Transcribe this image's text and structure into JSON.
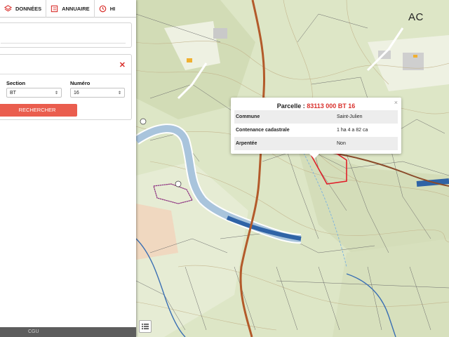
{
  "nav": {
    "tabs": [
      {
        "label": "DONNÉES",
        "icon": "layers-icon"
      },
      {
        "label": "ANNUAIRE",
        "icon": "directory-icon"
      },
      {
        "label": "HI",
        "icon": "clock-icon"
      }
    ]
  },
  "search_form": {
    "section_label": "Section",
    "section_value": "BT",
    "numero_label": "Numéro",
    "numero_value": "16",
    "search_button": "RECHERCHER",
    "close_icon": "close-icon"
  },
  "footer": {
    "text": "CGU"
  },
  "popup": {
    "title_prefix": "Parcelle : ",
    "title_ref": "83113 000 BT 16",
    "close": "×",
    "rows": [
      {
        "key": "Commune",
        "value": "Saint-Julien"
      },
      {
        "key": "Contenance cadastrale",
        "value": "1 ha 4 a 82 ca"
      },
      {
        "key": "Arpentée",
        "value": "Non"
      }
    ]
  },
  "map": {
    "corner_label": "AC",
    "highlight_color": "#e0202a",
    "river_color": "#3a6fb3",
    "road_color": "#b35a2a"
  }
}
